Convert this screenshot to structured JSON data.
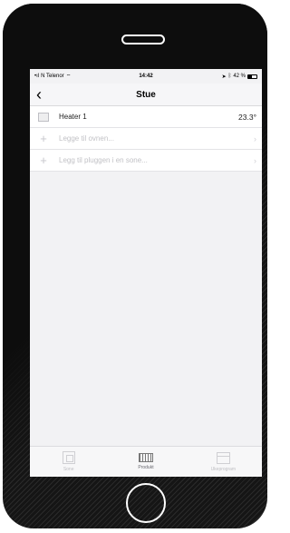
{
  "statusbar": {
    "carrier": "N Telenor",
    "time": "14:42",
    "battery_text": "42 %",
    "battery_level": 0.42
  },
  "navbar": {
    "back_glyph": "‹",
    "title": "Stue"
  },
  "list": {
    "heater": {
      "label": "Heater 1",
      "value": "23.3°"
    },
    "add_oven": "Legge til ovnen...",
    "add_plug": "Legg til pluggen i en sone..."
  },
  "tabs": [
    {
      "label": "Sone",
      "icon": "zone-icon",
      "active": false
    },
    {
      "label": "Produkt",
      "icon": "heater-product-icon",
      "active": true
    },
    {
      "label": "Ukeprogram",
      "icon": "calendar-icon",
      "active": false
    }
  ]
}
